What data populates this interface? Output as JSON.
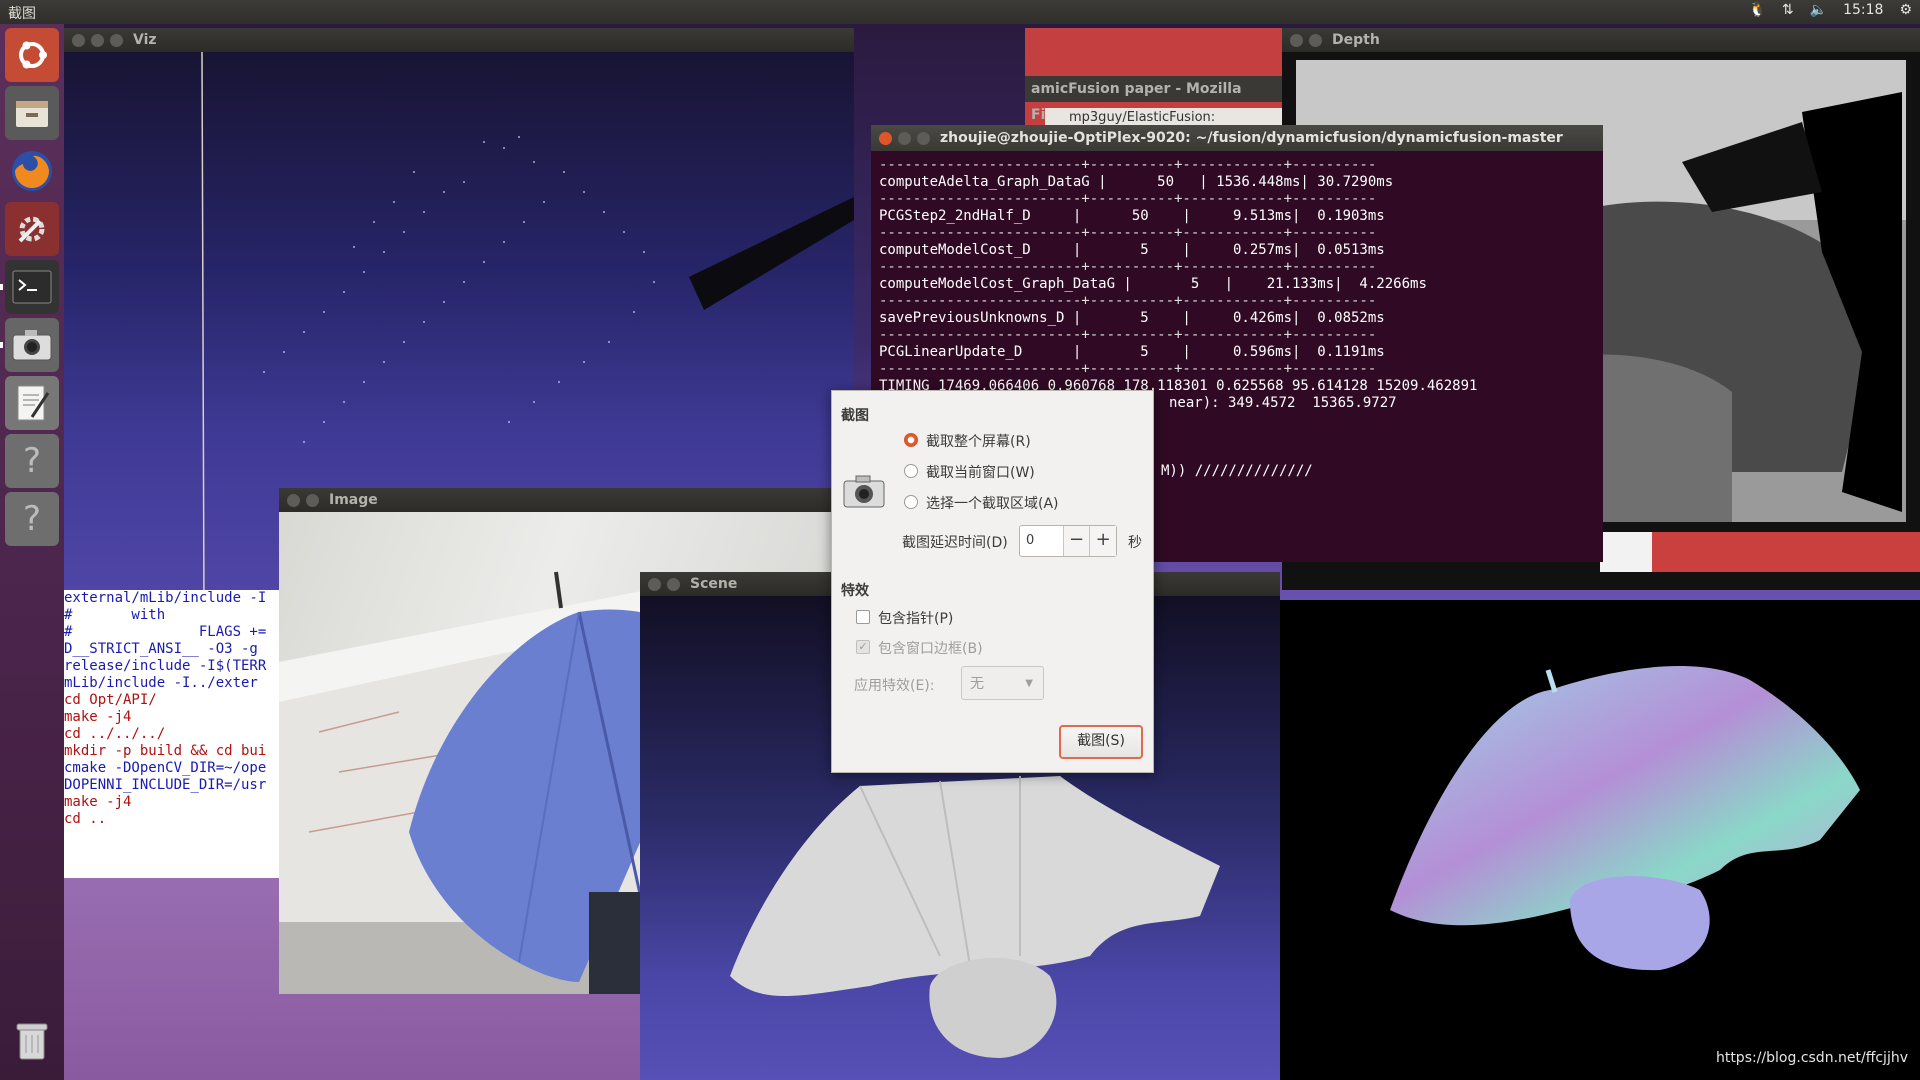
{
  "top_panel": {
    "app_title": "截图",
    "time": "15:18",
    "tray_icons": [
      "keyboard-icon",
      "network-icon",
      "volume-icon",
      "gear-icon"
    ]
  },
  "launcher": {
    "items": [
      "ubuntu-icon",
      "files-icon",
      "firefox-icon",
      "settings-icon",
      "terminal-icon",
      "screenshot-icon",
      "text-editor-icon",
      "help-icon",
      "help-icon",
      "trash-icon"
    ]
  },
  "viz_window": {
    "title": "Viz"
  },
  "depth_window": {
    "title": "Depth"
  },
  "image_window": {
    "title": "Image"
  },
  "scene_window": {
    "title": "Scene"
  },
  "firefox": {
    "title": "amicFusion paper - Mozilla Firefox",
    "tab": "mp3guy/ElasticFusion:"
  },
  "code_editor": {
    "lines": [
      "external/mLib/include -I",
      "#       with",
      "#               FLAGS +=",
      "D__STRICT_ANSI__ -O3 -g",
      "release/include -I$(TERR",
      "mLib/include -I../exter",
      "cd Opt/API/",
      "make -j4",
      "cd ../../../",
      "",
      "mkdir -p build && cd bui",
      "cmake -DOpenCV_DIR=~/ope",
      "DOPENNI_INCLUDE_DIR=/usr",
      "make -j4",
      "cd .."
    ]
  },
  "terminal": {
    "title": "zhoujie@zhoujie-OptiPlex-9020: ~/fusion/dynamicfusion/dynamicfusion-master",
    "separator": "------------------------+----------+------------+----------",
    "rows": [
      "computeAdelta_Graph_DataG |      50   | 1536.448ms| 30.7290ms",
      "PCGStep2_2ndHalf_D     |      50    |     9.513ms|  0.1903ms",
      "computeModelCost_D     |       5    |     0.257ms|  0.0513ms",
      "computeModelCost_Graph_DataG |       5   |    21.133ms|  4.2266ms",
      "savePreviousUnknowns_D |       5    |     0.426ms|  0.0852ms",
      "PCGLinearUpdate_D      |       5    |     0.596ms|  0.1191ms"
    ],
    "timing": "TIMING 17469.066406 0.960768 178.118301 0.625568 95.614128 15209.462891",
    "partial1": "near): 349.4572  15365.9727",
    "partial2": "M)) //////////////"
  },
  "dialog": {
    "section_capture": "截图",
    "options": [
      {
        "label": "截取整个屏幕(R)",
        "selected": true
      },
      {
        "label": "截取当前窗口(W)",
        "selected": false
      },
      {
        "label": "选择一个截取区域(A)",
        "selected": false
      }
    ],
    "delay_label": "截图延迟时间(D)",
    "delay_value": "0",
    "minus": "−",
    "plus": "+",
    "delay_unit": "秒",
    "section_effects": "特效",
    "include_pointer": "包含指针(P)",
    "include_border": "包含窗口边框(B)",
    "apply_effect_label": "应用特效(E):",
    "apply_effect_value": "无",
    "snap_button": "截图(S)"
  },
  "watermark": "https://blog.csdn.net/ffcjjhv",
  "colors": {
    "terminal_bg": "#300a24",
    "ubuntu_orange": "#e05a2d",
    "launcher_bg": "#5b2f5a"
  }
}
